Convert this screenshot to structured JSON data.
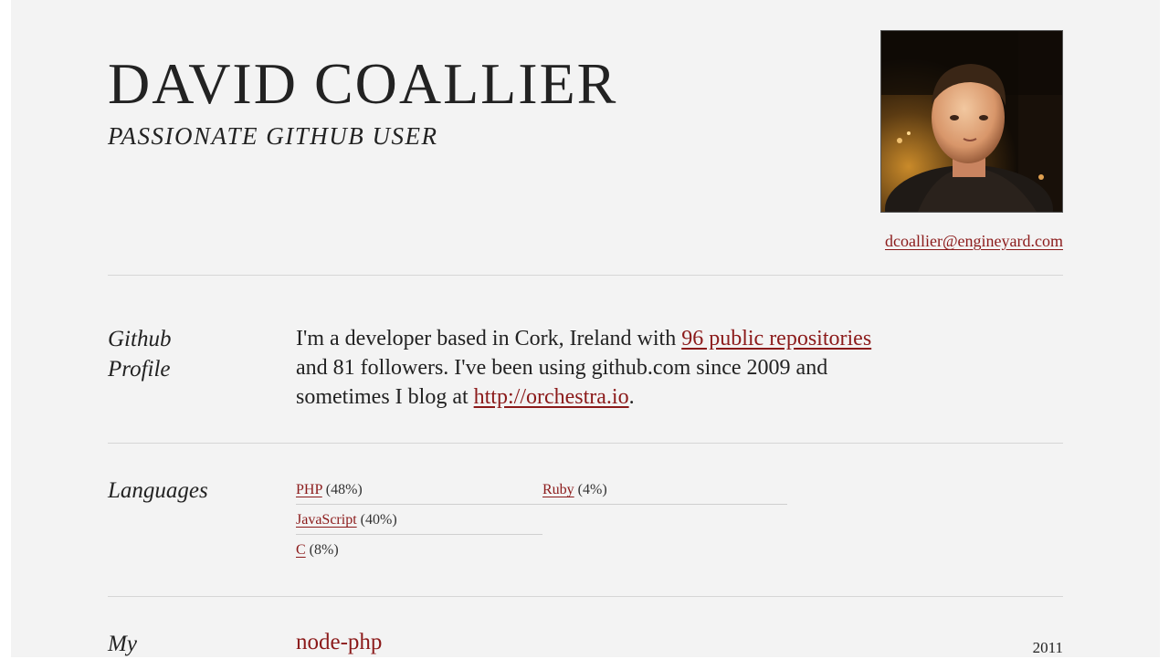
{
  "header": {
    "name": "DAVID COALLIER",
    "tagline": "PASSIONATE GITHUB USER",
    "email": "dcoallier@engineyard.com"
  },
  "profile": {
    "label_line1": "Github",
    "label_line2": "Profile",
    "text_part1": "I'm a developer based in Cork, Ireland with ",
    "repos_link": "96 public repositories",
    "text_part2": " and 81 followers. I've been using github.com since 2009 and sometimes I blog at ",
    "blog_link": "http://orchestra.io",
    "text_part3": "."
  },
  "languages": {
    "label": "Languages",
    "items": [
      {
        "name": "PHP",
        "percent": "(48%)",
        "share": 48
      },
      {
        "name": "JavaScript",
        "percent": "(40%)",
        "share": 40
      },
      {
        "name": "C",
        "percent": "(8%)",
        "share": 8
      },
      {
        "name": "Ruby",
        "percent": "(4%)",
        "share": 4
      }
    ]
  },
  "projects": {
    "label": "My",
    "items": [
      {
        "title": "node-php",
        "year": "2011"
      }
    ]
  },
  "colors": {
    "link": "#8b1a1a",
    "background": "#f3f3f3"
  }
}
